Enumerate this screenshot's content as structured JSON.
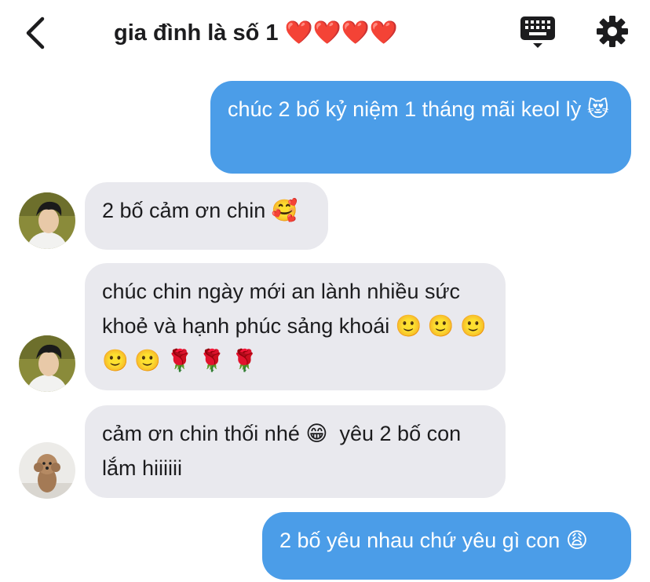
{
  "header": {
    "title": "gia đình là số 1 ❤️❤️❤️❤️"
  },
  "messages": [
    {
      "direction": "out",
      "text": "chúc 2 bố kỷ niệm 1 tháng mãi keol lỳ 😻"
    },
    {
      "direction": "in",
      "avatar": "boy-avatar",
      "text": "2 bố cảm ơn chin 🥰"
    },
    {
      "direction": "in",
      "avatar": "boy-avatar",
      "text": "chúc chin ngày mới an lành nhiều sức khoẻ và hạnh phúc sảng khoái 🙂 🙂 🙂 🙂 🙂 🌹 🌹 🌹"
    },
    {
      "direction": "in",
      "avatar": "dog-avatar",
      "text": "cảm ơn chin thối nhé 😁  yêu 2 bố con lắm hiiiiii"
    },
    {
      "direction": "out",
      "text": "2 bố yêu nhau chứ yêu gì con 😩"
    }
  ],
  "colors": {
    "outgoing_bubble": "#4b9de8",
    "incoming_bubble": "#e9e9ee",
    "text": "#1c1c1e"
  },
  "icons": [
    "back-chevron-icon",
    "keyboard-icon",
    "gear-icon"
  ]
}
